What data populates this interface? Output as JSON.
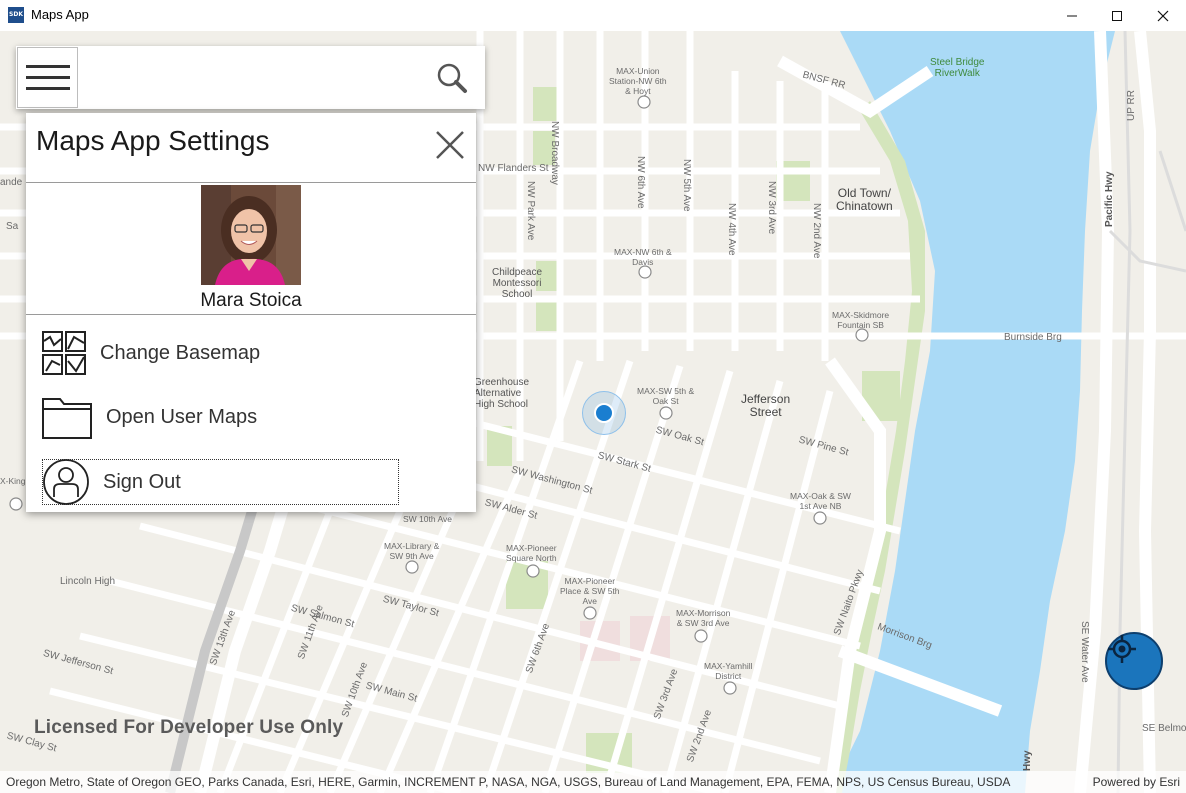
{
  "window": {
    "title": "Maps App",
    "icon_text": "SDK",
    "minimize_icon": "minimize-icon",
    "maximize_icon": "maximize-icon",
    "close_icon": "close-icon"
  },
  "search": {
    "menu_icon": "hamburger-menu-icon",
    "search_icon": "search-icon"
  },
  "settings": {
    "title": "Maps App Settings",
    "close_icon": "close-icon",
    "user_name": "Mara Stoica",
    "items": [
      {
        "label": "Change Basemap",
        "icon": "basemap-gallery-icon"
      },
      {
        "label": "Open User Maps",
        "icon": "folder-icon"
      },
      {
        "label": "Sign Out",
        "icon": "user-icon"
      }
    ]
  },
  "map": {
    "watermark": "Licensed For Developer Use Only",
    "attribution": "Oregon Metro, State of Oregon GEO, Parks Canada, Esri, HERE, Garmin, INCREMENT P, NASA, NGA, USGS, Bureau of Land Management, EPA, FEMA, NPS, US Census Bureau, USDA",
    "powered_by": "Powered by Esri",
    "labels": {
      "steel_bridge": "Steel Bridge\nRiverWalk",
      "bnsf": "BNSF RR",
      "max_union": "MAX-Union\nStation-NW 6th\n& Hoyt",
      "nw_broadway": "NW Broadway",
      "nw_6th": "NW 6th Ave",
      "nw_5th": "NW 5th Ave",
      "nw_4th": "NW 4th Ave",
      "nw_3rd": "NW 3rd Ave",
      "nw_2nd": "NW 2nd Ave",
      "nw_flanders": "NW Flanders St",
      "nw_park": "NW Park Ave",
      "old_town": "Old Town/\nChinatown",
      "pacific_hwy": "Pacific Hwy",
      "max_nw6_davis": "MAX-NW 6th &\nDavis",
      "childpeace": "Childpeace\nMontessori\nSchool",
      "max_skidmore": "MAX-Skidmore\nFountain SB",
      "burnside": "Burnside Brg",
      "greenhouse": "Greenhouse\nAlternative\nHigh School",
      "max_sw5_oak": "MAX-SW 5th &\nOak St",
      "jefferson": "Jefferson\nStreet",
      "sw_oak": "SW Oak St",
      "sw_pine": "SW Pine St",
      "sw_stark": "SW Stark St",
      "sw_washington": "SW Washington St",
      "sw_alder": "SW Alder St",
      "max_oak_1st": "MAX-Oak & SW\n1st Ave NB",
      "sw_10th": "SW 10th Ave",
      "max_library": "MAX-Library &\nSW 9th Ave",
      "max_pioneer_sq": "MAX-Pioneer\nSquare North",
      "max_pioneer_pl": "MAX-Pioneer\nPlace & SW 5th\nAve",
      "lincoln_high": "Lincoln High",
      "max_morrison": "MAX-Morrison\n& SW 3rd Ave",
      "max_yamhill": "MAX-Yamhill\nDistrict",
      "sw_salmon": "SW Salmon St",
      "sw_taylor": "SW Taylor St",
      "sw_jefferson": "SW Jefferson St",
      "sw_main": "SW Main St",
      "sw_clay": "SW Clay St",
      "sw_13th": "SW 13th Ave",
      "sw_11th": "SW 11th Ave",
      "sw_10th_ave": "SW 10th Ave",
      "sw_6th": "SW 6th Ave",
      "sw_3rd": "SW 3rd Ave",
      "sw_2nd": "SW 2nd Ave",
      "sw_naito": "SW Naito Pkwy",
      "morrison_brg": "Morrison Brg",
      "se_water": "SE Water Ave",
      "se_belmo": "SE Belmo",
      "hwy": "Hwy",
      "max_king": "X-King",
      "up_rr": "UP RR",
      "ande": "ande",
      "sa": "Sa"
    }
  },
  "colors": {
    "accent": "#1b75bc",
    "water": "#aadaf6",
    "park": "#d4e5bc",
    "road": "#ffffff",
    "land": "#f1efe9"
  }
}
